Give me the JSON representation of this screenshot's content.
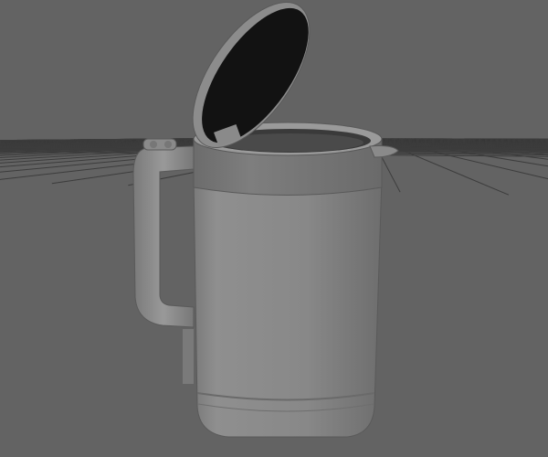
{
  "viewport": {
    "background_color": "#636363",
    "grid_color": "#3c3c3c",
    "model_color": "#8a8a8a",
    "lid_interior_color": "#121212"
  }
}
